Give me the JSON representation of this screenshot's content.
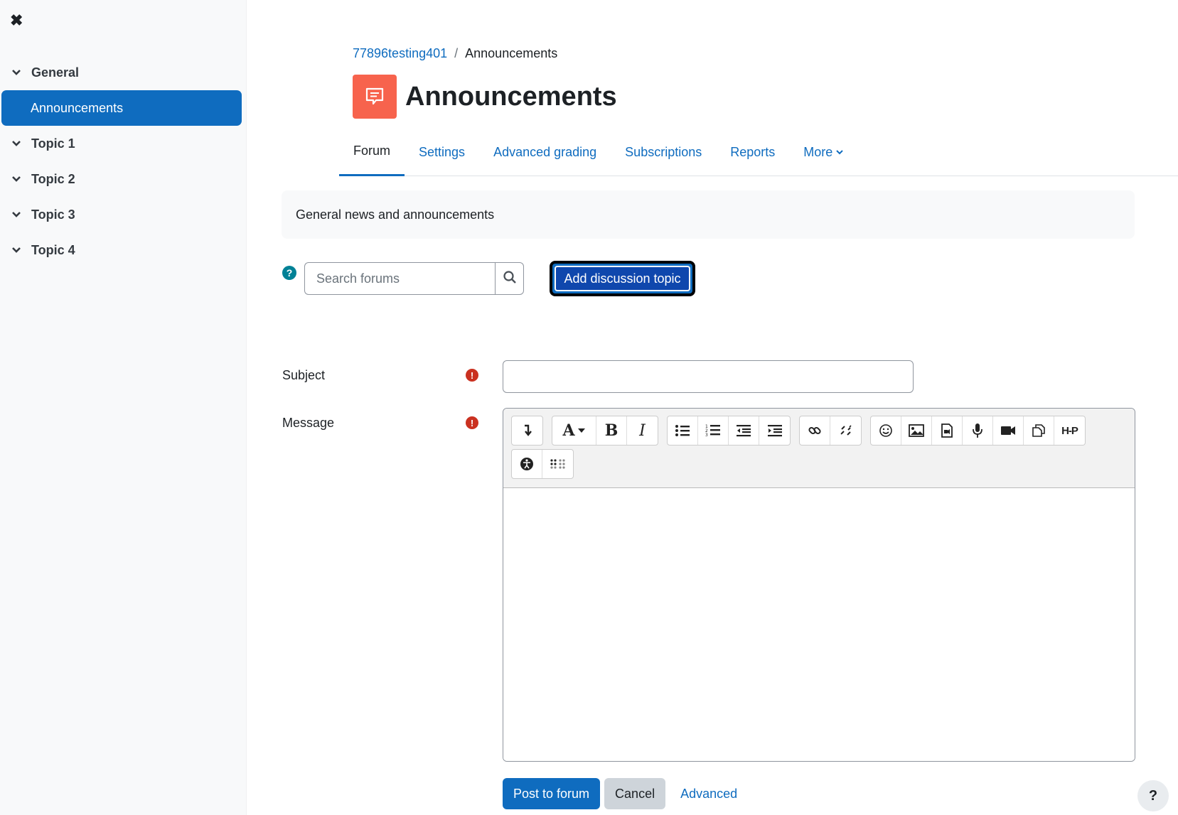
{
  "drawer": {
    "close_glyph": "✖",
    "sections": [
      {
        "label": "General"
      },
      {
        "label": "Topic 1"
      },
      {
        "label": "Topic 2"
      },
      {
        "label": "Topic 3"
      },
      {
        "label": "Topic 4"
      }
    ],
    "active_item": "Announcements"
  },
  "breadcrumb": {
    "course": "77896testing401",
    "separator": "/",
    "current": "Announcements"
  },
  "header": {
    "title": "Announcements",
    "icon": "forum-chat-icon",
    "icon_color": "#f7634d"
  },
  "secondary_nav": {
    "tabs": [
      {
        "label": "Forum"
      },
      {
        "label": "Settings"
      },
      {
        "label": "Advanced grading"
      },
      {
        "label": "Subscriptions"
      },
      {
        "label": "Reports"
      },
      {
        "label": "More"
      }
    ]
  },
  "intro": {
    "text": "General news and announcements"
  },
  "search": {
    "placeholder": "Search forums",
    "help_glyph": "?"
  },
  "add_topic": {
    "label": "Add discussion topic"
  },
  "form": {
    "subject_label": "Subject",
    "message_label": "Message",
    "required_glyph": "!",
    "toolbar_icons": [
      "show-more-icon",
      "font-style-icon",
      "bold-icon",
      "italic-icon",
      "unordered-list-icon",
      "ordered-list-icon",
      "outdent-icon",
      "indent-icon",
      "link-icon",
      "unlink-icon",
      "emoji-icon",
      "image-icon",
      "media-icon",
      "record-audio-icon",
      "record-video-icon",
      "manage-files-icon",
      "h5p-icon",
      "accessibility-checker-icon",
      "screenreader-helper-icon"
    ],
    "toolbar_text": {
      "bold": "B",
      "italic": "I",
      "font": "A",
      "h5p": "H-P"
    },
    "submit_label": "Post to forum",
    "cancel_label": "Cancel",
    "advanced_label": "Advanced"
  },
  "footer": {
    "help_glyph": "?"
  },
  "colors": {
    "primary": "#0f6cbf",
    "drawer_bg": "#f8f9fa",
    "required": "#ca3120",
    "help": "#008196"
  }
}
